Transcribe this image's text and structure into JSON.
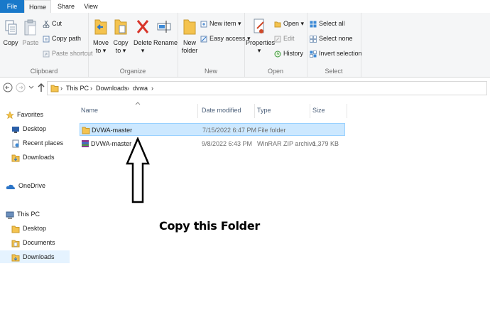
{
  "tabs": {
    "file": "File",
    "home": "Home",
    "share": "Share",
    "view": "View"
  },
  "ribbon": {
    "clipboard": {
      "label": "Clipboard",
      "copy": "Copy",
      "paste": "Paste",
      "cut": "Cut",
      "copy_path": "Copy path",
      "paste_shortcut": "Paste shortcut"
    },
    "organize": {
      "label": "Organize",
      "move_to": "Move",
      "move_to2": "to",
      "copy_to": "Copy",
      "copy_to2": "to",
      "delete": "Delete",
      "rename": "Rename"
    },
    "new": {
      "label": "New",
      "new_folder": "New",
      "new_folder2": "folder",
      "new_item": "New item",
      "easy_access": "Easy access"
    },
    "open": {
      "label": "Open",
      "properties": "Properties",
      "open": "Open",
      "edit": "Edit",
      "history": "History"
    },
    "select": {
      "label": "Select",
      "select_all": "Select all",
      "select_none": "Select none",
      "invert": "Invert selection"
    }
  },
  "address": {
    "crumbs": [
      "This PC",
      "Downloads",
      "dvwa"
    ]
  },
  "nav": {
    "favorites": "Favorites",
    "fav_items": [
      "Desktop",
      "Recent places",
      "Downloads"
    ],
    "onedrive": "OneDrive",
    "thispc": "This PC",
    "pc_items": [
      "Desktop",
      "Documents",
      "Downloads"
    ]
  },
  "columns": {
    "name": "Name",
    "date": "Date modified",
    "type": "Type",
    "size": "Size"
  },
  "files": [
    {
      "name": "DVWA-master",
      "date": "7/15/2022 6:47 PM",
      "type": "File folder",
      "size": ""
    },
    {
      "name": "DVWA-master",
      "date": "9/8/2022 6:43 PM",
      "type": "WinRAR ZIP archive",
      "size": "1,379 KB"
    }
  ],
  "annotation": {
    "text": "Copy this Folder"
  },
  "colors": {
    "accent": "#1979ca",
    "selection": "#cce8ff",
    "folder": "#f4c34f"
  }
}
